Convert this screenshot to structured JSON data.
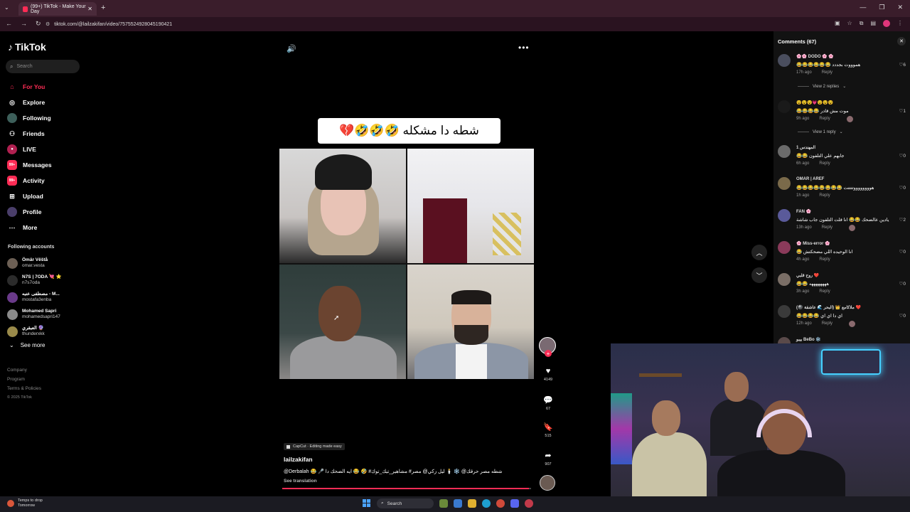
{
  "browser": {
    "tab_title": "(99+) TikTok - Make Your Day",
    "url": "tiktok.com/@lailzakifan/video/7575524928045190421"
  },
  "sidebar": {
    "logo": "TikTok",
    "search_placeholder": "Search",
    "nav": [
      {
        "label": "For You",
        "icon": "home-icon"
      },
      {
        "label": "Explore",
        "icon": "compass-icon"
      },
      {
        "label": "Following",
        "icon": "avatar-icon"
      },
      {
        "label": "Friends",
        "icon": "users-icon"
      },
      {
        "label": "LIVE",
        "icon": "live-icon"
      },
      {
        "label": "Messages",
        "icon": "messages-icon",
        "badge": "99+"
      },
      {
        "label": "Activity",
        "icon": "activity-icon",
        "badge": "99+"
      },
      {
        "label": "Upload",
        "icon": "plus-icon"
      },
      {
        "label": "Profile",
        "icon": "profile-icon"
      },
      {
        "label": "More",
        "icon": "more-icon"
      }
    ],
    "following_title": "Following accounts",
    "following": [
      {
        "name": "Ömär Věštå",
        "handle": "omar.vesta"
      },
      {
        "name": "N7S | 7ODA 💘 ⭐",
        "handle": "n7s7oda"
      },
      {
        "name": "مصطفى عنبه - M...",
        "handle": "mostafa3enba"
      },
      {
        "name": "Mohamed Sapri",
        "handle": "mohamedsapri147"
      },
      {
        "name": "العبقري 🔮",
        "handle": "thunderxkk"
      }
    ],
    "see_more": "See more",
    "footer": [
      "Company",
      "Program",
      "Terms & Policies"
    ],
    "copyright": "© 2025 TikTok"
  },
  "video": {
    "caption": "شطه دا مشكله 🤣🤣🤣💔",
    "capcut_label": "CapCut · Editing made easy",
    "author": "lailzakifan",
    "description": "@Derbalah 😂 🎤 شطه مصر حرقك@ ❄️ 🕯️ ليل زكي@ مصر# مشاهير_تيك_توك# 🤣 😂 ايه الضحك دا",
    "see_translation": "See translation",
    "progress": 0.99,
    "likes": "4149",
    "comments": "67",
    "saves": "515",
    "shares": "907"
  },
  "comments_panel": {
    "title": "Comments (67)",
    "items": [
      {
        "name": "🌸🌸 DODO 🌸 🌸",
        "text": "هموووت بجددد 😂😂😂😂😂😂",
        "time": "17h ago",
        "reply": "Reply",
        "likes": "6",
        "view_replies": "View 2 replies"
      },
      {
        "name": "😵😵😵💗😵😵😵",
        "text": "موت مش قادر 😂😂😂😂",
        "time": "9h ago",
        "reply": "Reply",
        "likes": "1",
        "view_replies": "View 1 reply"
      },
      {
        "name": "المهندس 1",
        "text": "جابهم علي التلفون 😂😂",
        "time": "6h ago",
        "reply": "Reply",
        "likes": "0"
      },
      {
        "name": "OMAR | AREF",
        "text": "هووووووووتتتتت 😂😂😂😂😂😂😂😂",
        "time": "1h ago",
        "reply": "Reply",
        "likes": "0"
      },
      {
        "name": "FAN 🌸",
        "text": "يادين عالضحك 😂😂 انا قلت التلفون جاب شاشة",
        "time": "13h ago",
        "reply": "Reply",
        "likes": "2"
      },
      {
        "name": "🌸 Miss-error 🌸",
        "text": "انا الوحيده اللي مضحكتش 😂",
        "time": "4h ago",
        "reply": "Reply",
        "likes": "0"
      },
      {
        "name": "روح قلبي ❤️",
        "text": "ههههههههه 😂😂",
        "time": "3h ago",
        "reply": "Reply",
        "likes": "0"
      },
      {
        "name": "(🎱 البحر 🌊 عاشقة) 👑 ملاكامع ❤️",
        "text": "اي دا اي اي 😂😂😂😂",
        "time": "12h ago",
        "reply": "Reply",
        "likes": "0"
      },
      {
        "name": "بيبو BeBo ❄️",
        "text": "",
        "time": "",
        "reply": "",
        "likes": ""
      }
    ]
  },
  "taskbar": {
    "weather_line1": "Temps to drop",
    "weather_line2": "Tomorrow",
    "search": "Search"
  }
}
